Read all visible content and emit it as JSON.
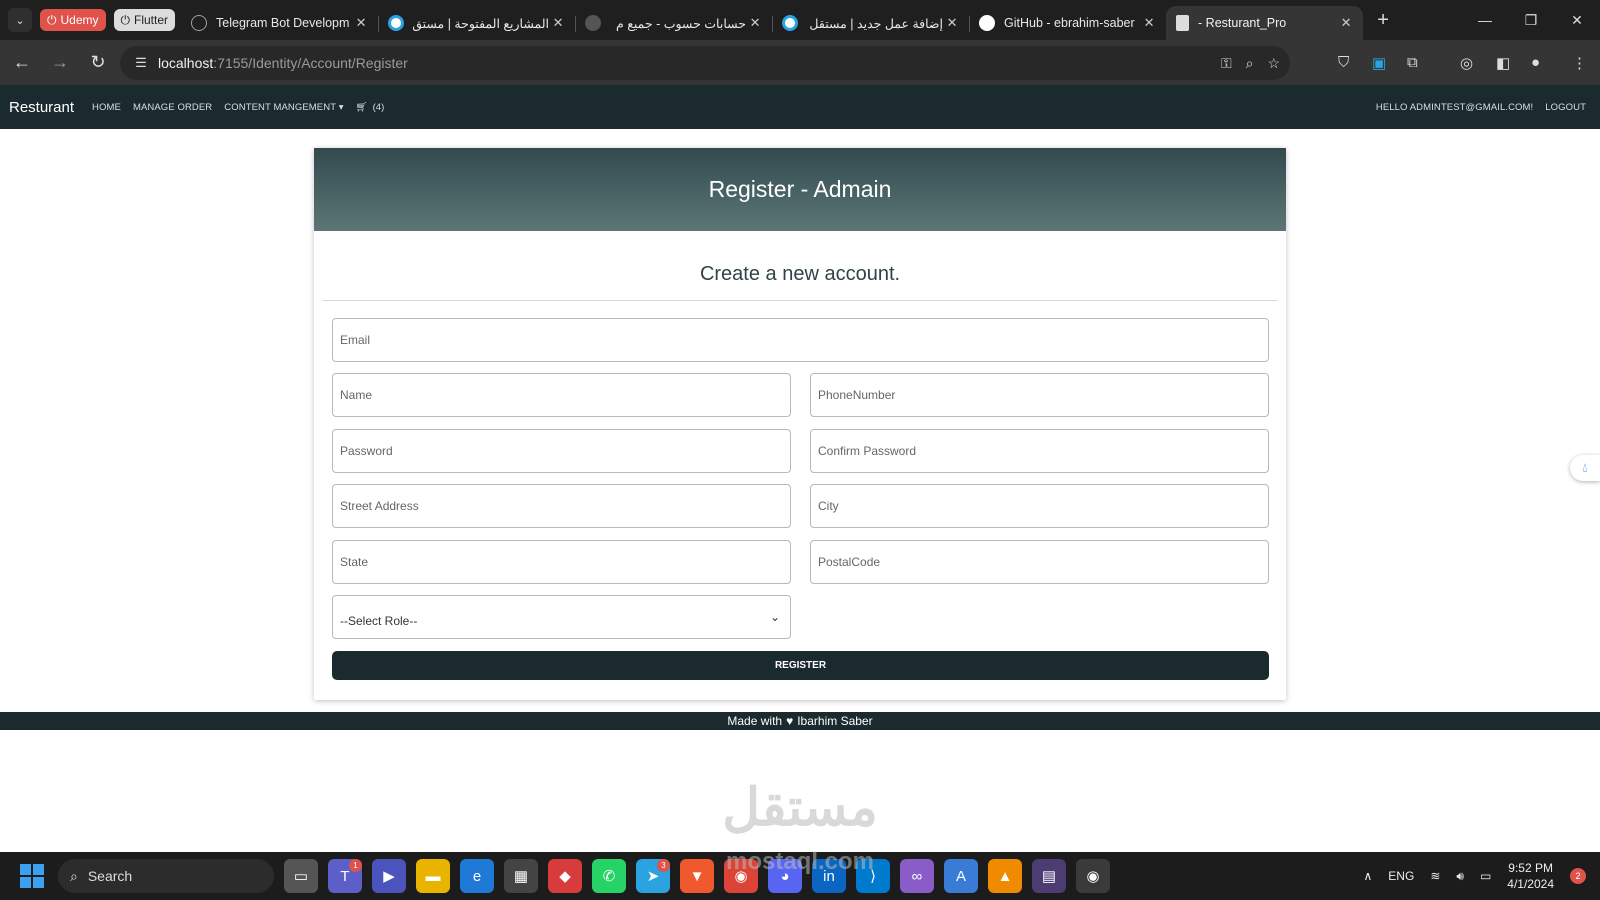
{
  "browser": {
    "pinned": [
      {
        "label": "Udemy",
        "icon": "udemy-icon"
      },
      {
        "label": "Flutter",
        "icon": "flutter-icon"
      }
    ],
    "tabs": [
      {
        "title": "Telegram Bot Developm",
        "icon": "openai-icon",
        "color": "#9aa0a6"
      },
      {
        "title": "المشاريع المفتوحة | مستق",
        "icon": "mostaql-icon",
        "color": "#2aa3e0"
      },
      {
        "title": "حسابات حسوب - جميع م",
        "icon": "loading-icon",
        "color": "#777777"
      },
      {
        "title": "إضافة عمل جديد | مستقل",
        "icon": "mostaql-icon",
        "color": "#2aa3e0"
      },
      {
        "title": "GitHub - ebrahim-saber",
        "icon": "github-icon",
        "color": "#ffffff"
      },
      {
        "title": "- Resturant_Pro",
        "icon": "document-icon",
        "color": "#dddddd"
      }
    ],
    "address": {
      "host": "localhost",
      "path": ":7155/Identity/Account/Register"
    }
  },
  "app": {
    "brand": "Resturant",
    "nav": [
      "HOME",
      "MANAGE ORDER",
      "CONTENT MANGEMENT"
    ],
    "cart_count": "(4)",
    "greeting": "HELLO ADMINTEST@GMAIL.COM!",
    "logout": "LOGOUT"
  },
  "form": {
    "header": "Register - Admain",
    "subtitle": "Create a new account.",
    "placeholders": {
      "email": "Email",
      "name": "Name",
      "phone": "PhoneNumber",
      "password": "Password",
      "confirm": "Confirm Password",
      "street": "Street Address",
      "city": "City",
      "state": "State",
      "postal": "PostalCode"
    },
    "role_selected": "--Select Role--",
    "submit": "REGISTER"
  },
  "footer": {
    "before": "Made with",
    "after": "Ibarhim Saber"
  },
  "watermark": {
    "arabic": "مستقل",
    "latin": "mostaql.com"
  },
  "taskbar": {
    "search": "Search",
    "lang": "ENG",
    "time": "9:52 PM",
    "date": "4/1/2024",
    "notifications": "2",
    "badges": {
      "teams": "1",
      "telegram": "3"
    }
  },
  "colors": {
    "navbar": "#1b2a2f",
    "header_top": "#324a4e",
    "header_bottom": "#5c7677"
  }
}
